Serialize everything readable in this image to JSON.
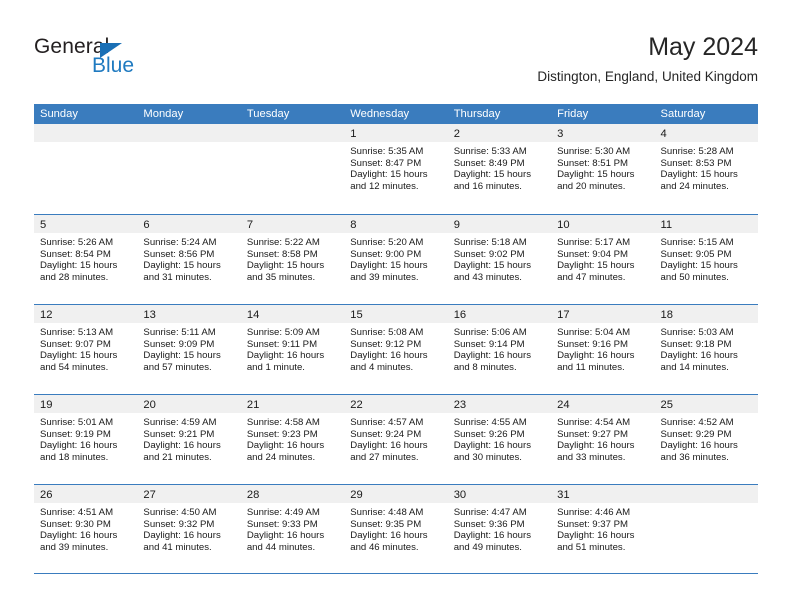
{
  "brand": {
    "word_one": "General",
    "word_two": "Blue",
    "triangle_icon": "triangle-icon",
    "accent_dark": "#231f20",
    "accent_blue": "#1f7ac0"
  },
  "header": {
    "title": "May 2024",
    "subtitle": "Distington, England, United Kingdom"
  },
  "theme": {
    "header_blue": "#3a7cbe",
    "datebar_gray": "#f0f0f0",
    "text": "#1a1a1a"
  },
  "calendar": {
    "weekday_headers": [
      "Sunday",
      "Monday",
      "Tuesday",
      "Wednesday",
      "Thursday",
      "Friday",
      "Saturday"
    ],
    "weeks": [
      [
        {
          "date": "",
          "lines": []
        },
        {
          "date": "",
          "lines": []
        },
        {
          "date": "",
          "lines": []
        },
        {
          "date": "1",
          "lines": [
            "Sunrise: 5:35 AM",
            "Sunset: 8:47 PM",
            "Daylight: 15 hours",
            "and 12 minutes."
          ]
        },
        {
          "date": "2",
          "lines": [
            "Sunrise: 5:33 AM",
            "Sunset: 8:49 PM",
            "Daylight: 15 hours",
            "and 16 minutes."
          ]
        },
        {
          "date": "3",
          "lines": [
            "Sunrise: 5:30 AM",
            "Sunset: 8:51 PM",
            "Daylight: 15 hours",
            "and 20 minutes."
          ]
        },
        {
          "date": "4",
          "lines": [
            "Sunrise: 5:28 AM",
            "Sunset: 8:53 PM",
            "Daylight: 15 hours",
            "and 24 minutes."
          ]
        }
      ],
      [
        {
          "date": "5",
          "lines": [
            "Sunrise: 5:26 AM",
            "Sunset: 8:54 PM",
            "Daylight: 15 hours",
            "and 28 minutes."
          ]
        },
        {
          "date": "6",
          "lines": [
            "Sunrise: 5:24 AM",
            "Sunset: 8:56 PM",
            "Daylight: 15 hours",
            "and 31 minutes."
          ]
        },
        {
          "date": "7",
          "lines": [
            "Sunrise: 5:22 AM",
            "Sunset: 8:58 PM",
            "Daylight: 15 hours",
            "and 35 minutes."
          ]
        },
        {
          "date": "8",
          "lines": [
            "Sunrise: 5:20 AM",
            "Sunset: 9:00 PM",
            "Daylight: 15 hours",
            "and 39 minutes."
          ]
        },
        {
          "date": "9",
          "lines": [
            "Sunrise: 5:18 AM",
            "Sunset: 9:02 PM",
            "Daylight: 15 hours",
            "and 43 minutes."
          ]
        },
        {
          "date": "10",
          "lines": [
            "Sunrise: 5:17 AM",
            "Sunset: 9:04 PM",
            "Daylight: 15 hours",
            "and 47 minutes."
          ]
        },
        {
          "date": "11",
          "lines": [
            "Sunrise: 5:15 AM",
            "Sunset: 9:05 PM",
            "Daylight: 15 hours",
            "and 50 minutes."
          ]
        }
      ],
      [
        {
          "date": "12",
          "lines": [
            "Sunrise: 5:13 AM",
            "Sunset: 9:07 PM",
            "Daylight: 15 hours",
            "and 54 minutes."
          ]
        },
        {
          "date": "13",
          "lines": [
            "Sunrise: 5:11 AM",
            "Sunset: 9:09 PM",
            "Daylight: 15 hours",
            "and 57 minutes."
          ]
        },
        {
          "date": "14",
          "lines": [
            "Sunrise: 5:09 AM",
            "Sunset: 9:11 PM",
            "Daylight: 16 hours",
            "and 1 minute."
          ]
        },
        {
          "date": "15",
          "lines": [
            "Sunrise: 5:08 AM",
            "Sunset: 9:12 PM",
            "Daylight: 16 hours",
            "and 4 minutes."
          ]
        },
        {
          "date": "16",
          "lines": [
            "Sunrise: 5:06 AM",
            "Sunset: 9:14 PM",
            "Daylight: 16 hours",
            "and 8 minutes."
          ]
        },
        {
          "date": "17",
          "lines": [
            "Sunrise: 5:04 AM",
            "Sunset: 9:16 PM",
            "Daylight: 16 hours",
            "and 11 minutes."
          ]
        },
        {
          "date": "18",
          "lines": [
            "Sunrise: 5:03 AM",
            "Sunset: 9:18 PM",
            "Daylight: 16 hours",
            "and 14 minutes."
          ]
        }
      ],
      [
        {
          "date": "19",
          "lines": [
            "Sunrise: 5:01 AM",
            "Sunset: 9:19 PM",
            "Daylight: 16 hours",
            "and 18 minutes."
          ]
        },
        {
          "date": "20",
          "lines": [
            "Sunrise: 4:59 AM",
            "Sunset: 9:21 PM",
            "Daylight: 16 hours",
            "and 21 minutes."
          ]
        },
        {
          "date": "21",
          "lines": [
            "Sunrise: 4:58 AM",
            "Sunset: 9:23 PM",
            "Daylight: 16 hours",
            "and 24 minutes."
          ]
        },
        {
          "date": "22",
          "lines": [
            "Sunrise: 4:57 AM",
            "Sunset: 9:24 PM",
            "Daylight: 16 hours",
            "and 27 minutes."
          ]
        },
        {
          "date": "23",
          "lines": [
            "Sunrise: 4:55 AM",
            "Sunset: 9:26 PM",
            "Daylight: 16 hours",
            "and 30 minutes."
          ]
        },
        {
          "date": "24",
          "lines": [
            "Sunrise: 4:54 AM",
            "Sunset: 9:27 PM",
            "Daylight: 16 hours",
            "and 33 minutes."
          ]
        },
        {
          "date": "25",
          "lines": [
            "Sunrise: 4:52 AM",
            "Sunset: 9:29 PM",
            "Daylight: 16 hours",
            "and 36 minutes."
          ]
        }
      ],
      [
        {
          "date": "26",
          "lines": [
            "Sunrise: 4:51 AM",
            "Sunset: 9:30 PM",
            "Daylight: 16 hours",
            "and 39 minutes."
          ]
        },
        {
          "date": "27",
          "lines": [
            "Sunrise: 4:50 AM",
            "Sunset: 9:32 PM",
            "Daylight: 16 hours",
            "and 41 minutes."
          ]
        },
        {
          "date": "28",
          "lines": [
            "Sunrise: 4:49 AM",
            "Sunset: 9:33 PM",
            "Daylight: 16 hours",
            "and 44 minutes."
          ]
        },
        {
          "date": "29",
          "lines": [
            "Sunrise: 4:48 AM",
            "Sunset: 9:35 PM",
            "Daylight: 16 hours",
            "and 46 minutes."
          ]
        },
        {
          "date": "30",
          "lines": [
            "Sunrise: 4:47 AM",
            "Sunset: 9:36 PM",
            "Daylight: 16 hours",
            "and 49 minutes."
          ]
        },
        {
          "date": "31",
          "lines": [
            "Sunrise: 4:46 AM",
            "Sunset: 9:37 PM",
            "Daylight: 16 hours",
            "and 51 minutes."
          ]
        },
        {
          "date": "",
          "lines": []
        }
      ]
    ]
  }
}
